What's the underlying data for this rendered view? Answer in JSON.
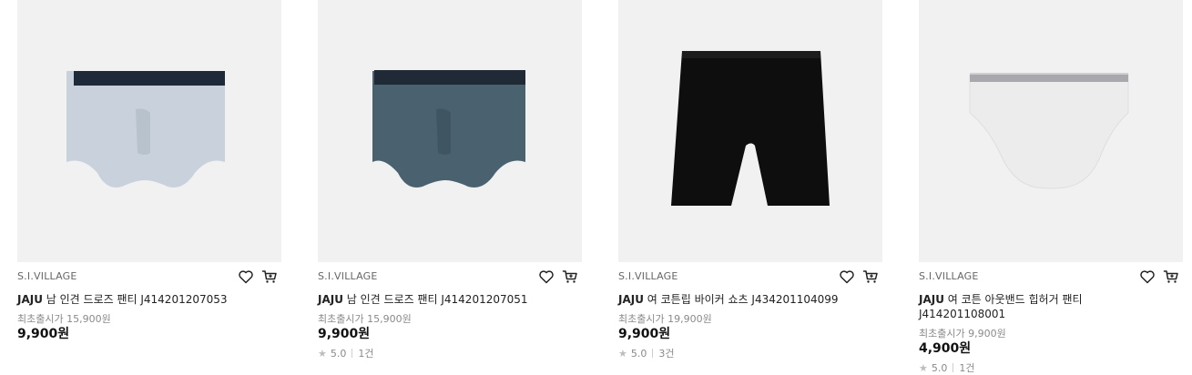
{
  "products": [
    {
      "brand": "S.I.VILLAGE",
      "brand_bold": "JAJU",
      "name_rest": " 남 인견 드로즈 팬티 J414201207053",
      "original_price_label": "최초출시가 15,900원",
      "price": "9,900원",
      "rating_value": "",
      "review_count": ""
    },
    {
      "brand": "S.I.VILLAGE",
      "brand_bold": "JAJU",
      "name_rest": " 남 인견 드로즈 팬티 J414201207051",
      "original_price_label": "최초출시가 15,900원",
      "price": "9,900원",
      "rating_value": "5.0",
      "review_count": "1건"
    },
    {
      "brand": "S.I.VILLAGE",
      "brand_bold": "JAJU",
      "name_rest": " 여 코튼립 바이커 쇼츠 J434201104099",
      "original_price_label": "최초출시가 19,900원",
      "price": "9,900원",
      "rating_value": "5.0",
      "review_count": "3건"
    },
    {
      "brand": "S.I.VILLAGE",
      "brand_bold": "JAJU",
      "name_rest": " 여 코튼 아웃밴드 힙허거 팬티 J414201108001",
      "original_price_label": "최초출시가 9,900원",
      "price": "4,900원",
      "rating_value": "5.0",
      "review_count": "1건"
    }
  ],
  "icons": {
    "wishlist": "heart-icon",
    "cart": "cart-icon",
    "star": "star-icon"
  },
  "colors": {
    "thumb_bg": "#f1f1f1",
    "muted_text": "#8a8a8a"
  }
}
